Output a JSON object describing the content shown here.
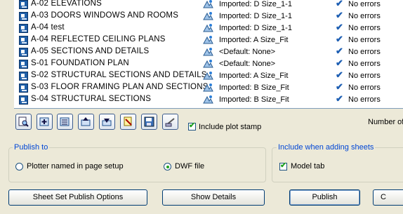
{
  "sheets": [
    {
      "name": "A-02 ELEVATIONS",
      "page_setup": "Imported: D Size_1-1",
      "status": "No errors"
    },
    {
      "name": "A-03 DOORS WINDOWS AND ROOMS",
      "page_setup": "Imported: D Size_1-1",
      "status": "No errors"
    },
    {
      "name": "A-04 test",
      "page_setup": "Imported: D Size_1-1",
      "status": "No errors"
    },
    {
      "name": "A-04 REFLECTED CEILING PLANS",
      "page_setup": "Imported: A Size_Fit",
      "status": "No errors"
    },
    {
      "name": "A-05 SECTIONS AND DETAILS",
      "page_setup": "<Default: None>",
      "status": "No errors"
    },
    {
      "name": "S-01 FOUNDATION PLAN",
      "page_setup": "<Default: None>",
      "status": "No errors"
    },
    {
      "name": "S-02 STRUCTURAL SECTIONS AND DETAILS",
      "page_setup": "Imported: A Size_Fit",
      "status": "No errors"
    },
    {
      "name": "S-03 FLOOR FRAMING PLAN AND SECTIONS",
      "page_setup": "Imported: B Size_Fit",
      "status": "No errors"
    },
    {
      "name": "S-04 STRUCTURAL SECTIONS",
      "page_setup": "Imported: B Size_Fit",
      "status": "No errors"
    }
  ],
  "toolbar": {
    "icons": [
      "preview-icon",
      "add-sheets-icon",
      "load-list-icon",
      "move-up-icon",
      "move-down-icon",
      "remove-icon",
      "save-list-icon",
      "plot-stamp-settings-icon"
    ],
    "include_plot_stamp_label": "Include plot stamp",
    "include_plot_stamp_checked": true,
    "number_label": "Number of"
  },
  "publish_to": {
    "legend": "Publish to",
    "plotter_label": "Plotter named in page setup",
    "dwf_label": "DWF file",
    "selected": "DWF file"
  },
  "include_when_adding": {
    "legend": "Include when adding sheets",
    "model_tab_label": "Model tab",
    "model_tab_checked": true
  },
  "buttons": {
    "sheet_set_options": "Sheet Set Publish Options",
    "show_details": "Show Details",
    "publish": "Publish",
    "cancel": "C"
  },
  "colors": {
    "accent": "#0046d5",
    "check": "#21a121",
    "sheet_icon": "#1f5fa8"
  }
}
